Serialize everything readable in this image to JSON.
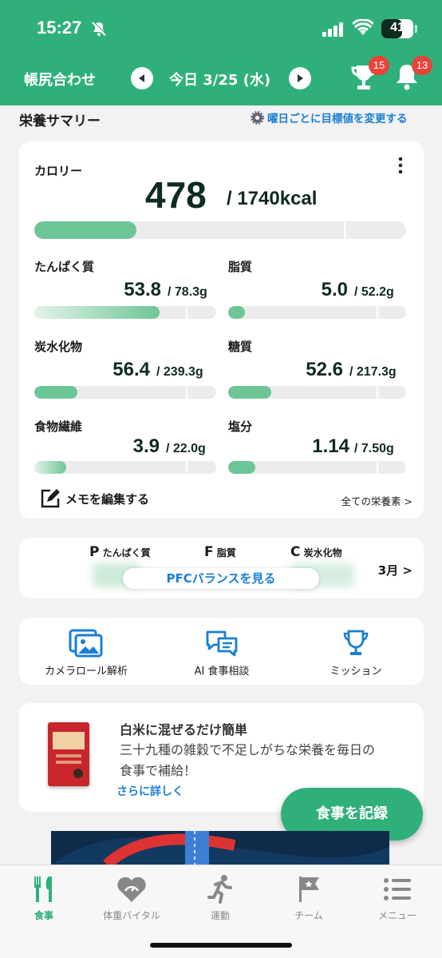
{
  "status_bar": {
    "time": "15:27",
    "battery": "41",
    "battery_fraction": 0.65
  },
  "nav": {
    "left_label": "帳尻合わせ",
    "date": "今日 3/25 (水)",
    "trophy_badge": "15",
    "bell_badge": "13"
  },
  "summary": {
    "title": "栄養サマリー",
    "change_link": "曜日ごとに目標値を変更する"
  },
  "calorie": {
    "label": "カロリー",
    "value": "478",
    "target": "/ 1740kcal",
    "fraction": 0.2747
  },
  "nutrients": [
    {
      "name": "たんぱく質",
      "value": "53.8",
      "target": "/ 78.3g",
      "fraction": 0.687
    },
    {
      "name": "脂質",
      "value": "5.0",
      "target": "/ 52.2g",
      "fraction": 0.096
    },
    {
      "name": "炭水化物",
      "value": "56.4",
      "target": "/ 239.3g",
      "fraction": 0.236
    },
    {
      "name": "糖質",
      "value": "52.6",
      "target": "/ 217.3g",
      "fraction": 0.242
    },
    {
      "name": "食物繊維",
      "value": "3.9",
      "target": "/ 22.0g",
      "fraction": 0.177
    },
    {
      "name": "塩分",
      "value": "1.14",
      "target": "/ 7.50g",
      "fraction": 0.152
    }
  ],
  "memo_label": "メモを編集する",
  "all_nutrients_link": "全ての栄養素 >",
  "pfc": {
    "p_letter": "P",
    "p_label": "たんぱく質",
    "f_letter": "F",
    "f_label": "脂質",
    "c_letter": "C",
    "c_label": "炭水化物",
    "button": "PFCバランスを見る",
    "month": "3月 >"
  },
  "actions": [
    {
      "label": "カメラロール解析",
      "icon": "photo-icon"
    },
    {
      "label": "AI 食事相談",
      "icon": "chat-icon"
    },
    {
      "label": "ミッション",
      "icon": "trophy-icon"
    }
  ],
  "ad": {
    "title": "白米に混ぜるだけ簡単",
    "body": "三十九種の雑穀で不足しがちな栄養を毎日の食事で補給！",
    "link": "さらに詳しく"
  },
  "fab_label": "食事を記録",
  "tabs": [
    {
      "label": "食事",
      "icon": "fork-knife-icon"
    },
    {
      "label": "体重バイタル",
      "icon": "heart-icon"
    },
    {
      "label": "運動",
      "icon": "runner-icon"
    },
    {
      "label": "チーム",
      "icon": "flag-icon"
    },
    {
      "label": "メニュー",
      "icon": "list-icon"
    }
  ],
  "colors": {
    "brand": "#2fb07a",
    "link": "#1a7fd4",
    "bar_fill": "#6ec596",
    "badge": "#e8443a"
  }
}
